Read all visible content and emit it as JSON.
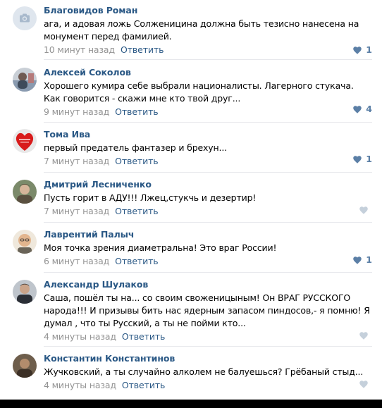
{
  "comments": [
    {
      "author": "Благовидов Роман",
      "avatar": "camera-placeholder",
      "text": "ага, и адовая ложь Солженицина должна быть тезисно нанесена на монумент перед фамилией.",
      "time": "10 минут назад",
      "reply": "Ответить",
      "likes": "1",
      "liked": true
    },
    {
      "author": "Алексей Соколов",
      "avatar": "photo",
      "text": "Хорошего кумира себе выбрали националисты. Лагерного стукача. Как говорится - скажи мне кто твой друг...",
      "time": "9 минут назад",
      "reply": "Ответить",
      "likes": "4",
      "liked": true
    },
    {
      "author": "Тома Ива",
      "avatar": "photo",
      "text": "первый предатель фантазер и брехун...",
      "time": "7 минут назад",
      "reply": "Ответить",
      "likes": "1",
      "liked": true
    },
    {
      "author": "Дмитрий Лесниченко",
      "avatar": "photo",
      "text": "Пусть горит в АДУ!!! Лжец,стукчь и дезертир!",
      "time": "7 минут назад",
      "reply": "Ответить",
      "likes": "",
      "liked": false
    },
    {
      "author": "Лаврентий Палыч",
      "avatar": "photo",
      "text": "Моя точка зрения диаметральна! Это враг России!",
      "time": "6 минут назад",
      "reply": "Ответить",
      "likes": "1",
      "liked": true
    },
    {
      "author": "Александр Шулаков",
      "avatar": "photo",
      "text": "Саша, пошёл ты на... со своим своженицыным! Он ВРАГ РУССКОГО народа!!! И призывы бить нас ядерным запасом пиндосов,- я помню! Я думал , что ты Русский, а ты не пойми кто...",
      "time": "4 минуты назад",
      "reply": "Ответить",
      "likes": "",
      "liked": false
    },
    {
      "author": "Константин Константинов",
      "avatar": "photo",
      "text": "Жучковский, а ты случайно алколем не балуешься? Грёбаный стыд...",
      "time": "4 минуты назад",
      "reply": "Ответить",
      "likes": "",
      "liked": false
    }
  ],
  "colors": {
    "author": "#2a5885",
    "meta": "#939393",
    "like_active": "#5b7fa6",
    "like_inactive": "#c5d0db",
    "divider": "#e7e8ec"
  }
}
